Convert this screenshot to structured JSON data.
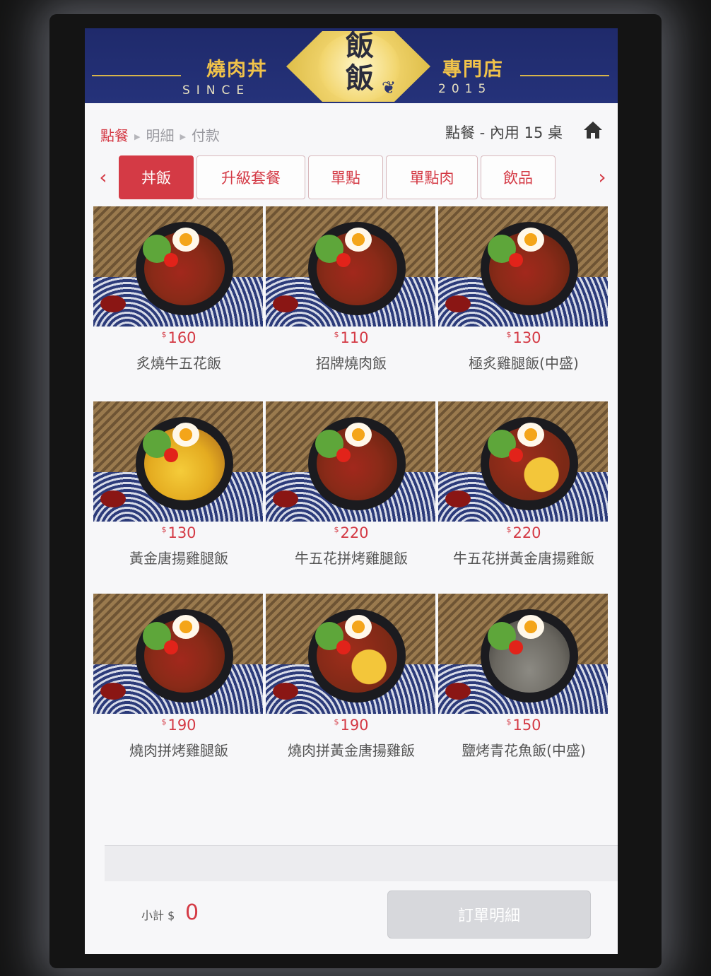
{
  "header": {
    "brand_left": "燒肉丼",
    "brand_right": "專門店",
    "since": "SINCE",
    "year": "2015",
    "logo_text": "飯飯"
  },
  "breadcrumb": {
    "steps": [
      "點餐",
      "明細",
      "付款"
    ],
    "active_index": 0
  },
  "status": {
    "table_label": "點餐 - 內用 15 桌"
  },
  "tabs": {
    "items": [
      "丼飯",
      "升級套餐",
      "單點",
      "單點肉",
      "飲品"
    ],
    "active_index": 0,
    "prev_arrow": "‹",
    "next_arrow": "›"
  },
  "menu": {
    "currency_symbol": "$",
    "items": [
      {
        "price": "160",
        "name": "炙燒牛五花飯",
        "style": "meat"
      },
      {
        "price": "110",
        "name": "招牌燒肉飯",
        "style": "meat"
      },
      {
        "price": "130",
        "name": "極炙雞腿飯(中盛)",
        "style": "meat"
      },
      {
        "price": "130",
        "name": "黃金唐揚雞腿飯",
        "style": "gold"
      },
      {
        "price": "220",
        "name": "牛五花拼烤雞腿飯",
        "style": "meat"
      },
      {
        "price": "220",
        "name": "牛五花拼黃金唐揚雞飯",
        "style": "mix"
      },
      {
        "price": "190",
        "name": "燒肉拼烤雞腿飯",
        "style": "meat"
      },
      {
        "price": "190",
        "name": "燒肉拼黃金唐揚雞飯",
        "style": "mix"
      },
      {
        "price": "150",
        "name": "鹽烤青花魚飯(中盛)",
        "style": "fish"
      }
    ]
  },
  "footer": {
    "subtotal_label": "小計 $",
    "subtotal_value": "0",
    "order_button": "訂單明細"
  },
  "colors": {
    "accent": "#d43a45",
    "banner": "#1f2a6b",
    "gold": "#f0c24a"
  },
  "icons": {
    "home": "home-icon",
    "prev": "chevron-left-icon",
    "next": "chevron-right-icon"
  }
}
